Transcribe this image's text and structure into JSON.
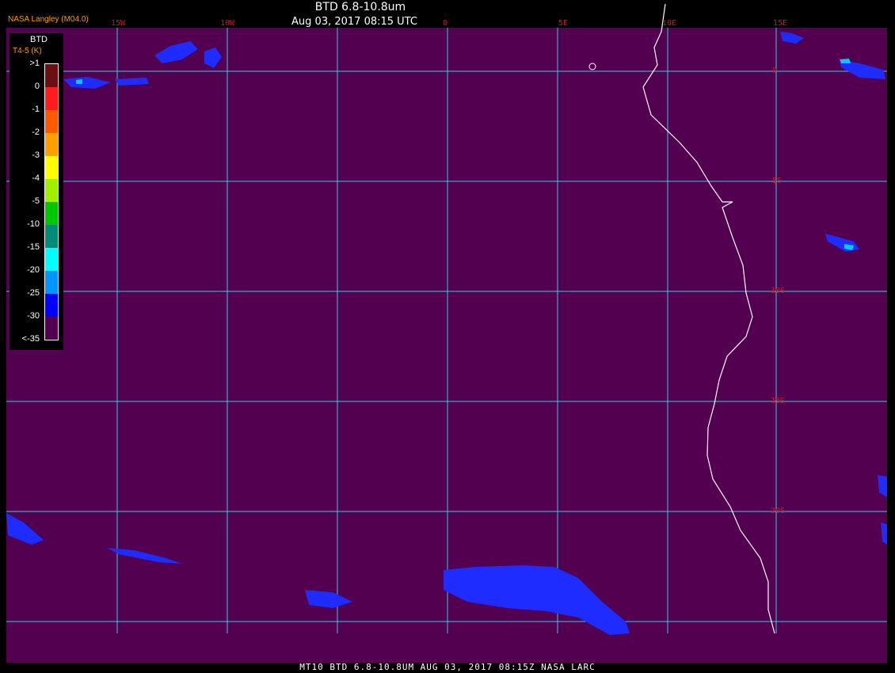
{
  "header": {
    "title": "BTD 6.8-10.8um",
    "subtitle": "Aug 03, 2017 08:15 UTC",
    "provider": "NASA Langley (M04.0)"
  },
  "footer": {
    "text": "MT10  BTD 6.8-10.8UM   AUG 03, 2017 08:15Z   NASA LARC"
  },
  "map": {
    "background_color": "#52004f",
    "grid_color": "#3cc8e6",
    "coast_color": "#ffffff",
    "longitude_labels": [
      "15W",
      "10W",
      "0",
      "5E",
      "10E",
      "15E"
    ],
    "latitude_labels": [
      "0",
      "5S",
      "10S",
      "15S",
      "20S"
    ]
  },
  "legend": {
    "title": "BTD",
    "units": "T4-5 (K)",
    "ticks": [
      ">1",
      "0",
      "-1",
      "-2",
      "-3",
      "-4",
      "-5",
      "-10",
      "-15",
      "-20",
      "-25",
      "-30",
      "<-35"
    ],
    "colors": [
      "#6b0f12",
      "#ff1c1c",
      "#ff5a00",
      "#ffa000",
      "#ffff00",
      "#a0f000",
      "#00c800",
      "#008c78",
      "#00ffff",
      "#0096ff",
      "#0000ff",
      "#52004f"
    ]
  }
}
